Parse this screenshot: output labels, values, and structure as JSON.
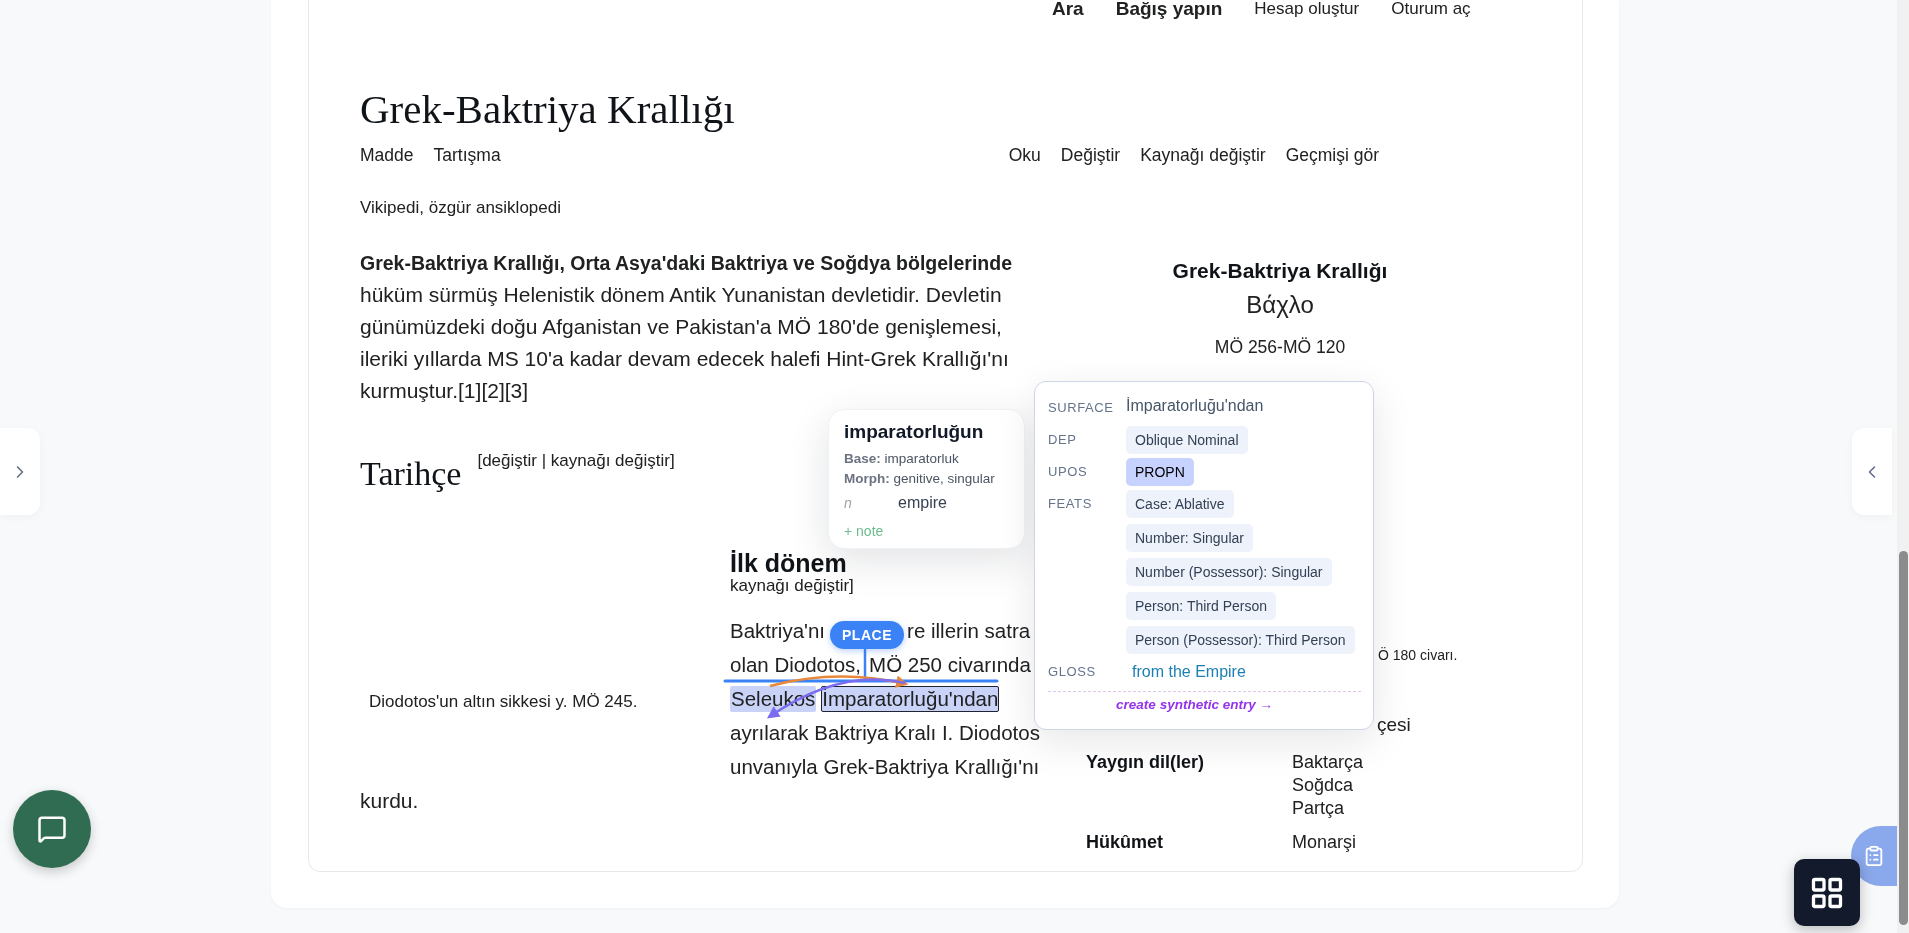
{
  "header_links": [
    {
      "label": "Ara",
      "bold": true
    },
    {
      "label": "Bağış yapın",
      "bold": true
    },
    {
      "label": "Hesap oluştur",
      "bold": false
    },
    {
      "label": "Oturum aç",
      "bold": false
    }
  ],
  "article": {
    "title": "Grek-Baktriya Krallığı",
    "tabs_left": [
      "Madde",
      "Tartışma"
    ],
    "tabs_right": [
      "Oku",
      "Değiştir",
      "Kaynağı değiştir",
      "Geçmişi gör"
    ],
    "tagline": "Vikipedi, özgür ansiklopedi",
    "lead": "**Grek-Baktriya Krallığı, Orta Asya'daki Baktriya ve Soğdya bölgelerinde** hüküm sürmüş Helenistik dönem Antik Yunanistan devletidir. Devletin günümüzdeki doğu Afganistan ve Pakistan'a MÖ 180'de genişlemesi, ileriki yıllarda MS 10'a kadar devam edecek halefi Hint-Grek Krallığı'nı kurmuştur.[1][2][3]",
    "section": {
      "title": "Tarihçe",
      "edit_links": "[değiştir | kaynağı değiştir]"
    },
    "subsection": {
      "title": "İlk dönem",
      "edit_links": "kaynağı değiştir]"
    },
    "caption": "Diodotos'un altın sikkesi y. MÖ 245.",
    "body": {
      "line_1_start": "Baktriya'nı",
      "line_1_end": "re illerin satra",
      "line_2_start": "olan Diodotos,",
      "line_2_end": "MÖ 250 civarında",
      "tokens": [
        {
          "text": "Seleukos",
          "boxed": false
        },
        {
          "text": "İmparatorluğu'ndan",
          "boxed": true
        }
      ],
      "line_4": "ayrılarak Baktriya Kralı I. Diodotos",
      "line_5": "unvanıyla Grek-Baktriya Krallığı'nı"
    },
    "trailing": "kurdu."
  },
  "infobox": {
    "title": "Grek-Baktriya Krallığı",
    "native_name": "Βάχλο",
    "dates": "MÖ 256-MÖ 120",
    "fragments": [
      "Ö 180 civarı.",
      "çesi"
    ],
    "rows": [
      {
        "label": "Yaygın dil(ler)",
        "values": [
          "Baktarça",
          "Soğdca",
          "Partça"
        ]
      },
      {
        "label": "Hükûmet",
        "values": [
          "Monarşi"
        ]
      }
    ]
  },
  "annotation": {
    "label": "PLACE"
  },
  "token_card": {
    "word": "imparatorluğun",
    "base": "**Base:** imparatorluk",
    "morph": "**Morph:** genitive, singular",
    "pos": "n",
    "gloss": "empire",
    "note_link": "+ note"
  },
  "analysis_card": {
    "surface_label": "SURFACE",
    "surface": "İmparatorluğu'ndan",
    "dep_label": "DEP",
    "dep": "Oblique Nominal",
    "upos_label": "UPOS",
    "upos": {
      "value": "PROPN",
      "selected": true
    },
    "feats_label": "FEATS",
    "feats": [
      "Case: Ablative",
      "Number: Singular",
      "Number (Possessor): Singular",
      "Person: Third Person",
      "Person (Possessor): Third Person"
    ],
    "gloss_label": "GLOSS",
    "gloss": "from the Empire",
    "action": "create synthetic entry →"
  }
}
